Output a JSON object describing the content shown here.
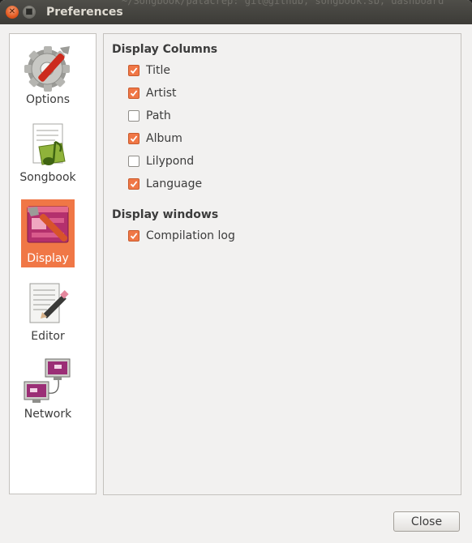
{
  "window": {
    "title": "Preferences",
    "background_text": "~/Songbook/patacrep: git@github; songbook.sb; dashboard"
  },
  "sidebar": {
    "items": [
      {
        "label": "Options",
        "icon": "options-icon",
        "selected": false
      },
      {
        "label": "Songbook",
        "icon": "songbook-icon",
        "selected": false
      },
      {
        "label": "Display",
        "icon": "display-icon",
        "selected": true
      },
      {
        "label": "Editor",
        "icon": "editor-icon",
        "selected": false
      },
      {
        "label": "Network",
        "icon": "network-icon",
        "selected": false
      }
    ]
  },
  "display": {
    "columns_title": "Display Columns",
    "columns": [
      {
        "label": "Title",
        "checked": true
      },
      {
        "label": "Artist",
        "checked": true
      },
      {
        "label": "Path",
        "checked": false
      },
      {
        "label": "Album",
        "checked": true
      },
      {
        "label": "Lilypond",
        "checked": false
      },
      {
        "label": "Language",
        "checked": true
      }
    ],
    "windows_title": "Display windows",
    "windows": [
      {
        "label": "Compilation log",
        "checked": true
      }
    ]
  },
  "footer": {
    "close_label": "Close"
  },
  "colors": {
    "accent": "#f07746",
    "titlebar": "#3c3b37",
    "window_bg": "#f2f1f0"
  }
}
